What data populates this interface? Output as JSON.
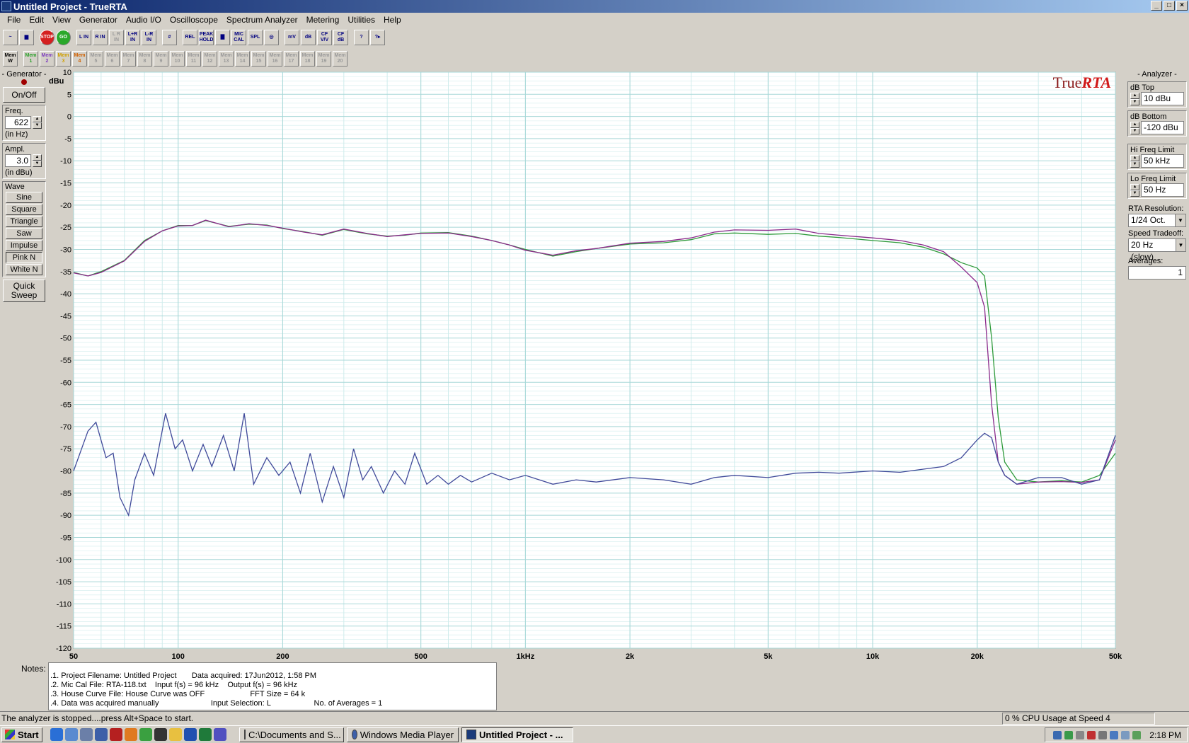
{
  "window": {
    "title": "Untitled Project - TrueRTA"
  },
  "menu": [
    "File",
    "Edit",
    "View",
    "Generator",
    "Audio I/O",
    "Oscilloscope",
    "Spectrum Analyzer",
    "Metering",
    "Utilities",
    "Help"
  ],
  "toolbar1": [
    {
      "label": "~",
      "name": "sine-wave-icon"
    },
    {
      "label": "▆",
      "name": "rta-icon"
    },
    {
      "label": "STOP",
      "name": "stop-button"
    },
    {
      "label": "GO",
      "name": "go-button"
    },
    {
      "label": "L IN",
      "name": "l-in-button"
    },
    {
      "label": "R IN",
      "name": "r-in-button"
    },
    {
      "label": "L R IN",
      "name": "lr-in-button"
    },
    {
      "label": "L+R IN",
      "name": "l-plus-r-in-button"
    },
    {
      "label": "L-R IN",
      "name": "l-minus-r-in-button"
    },
    {
      "label": "#",
      "name": "grid-icon"
    },
    {
      "label": "REL",
      "name": "rel-button"
    },
    {
      "label": "PEAK HOLD",
      "name": "peak-hold-button"
    },
    {
      "label": "▇",
      "name": "bars-icon"
    },
    {
      "label": "MIC CAL",
      "name": "mic-cal-button"
    },
    {
      "label": "SPL",
      "name": "spl-button"
    },
    {
      "label": "◎",
      "name": "target-icon"
    },
    {
      "label": "mV",
      "name": "mv-button"
    },
    {
      "label": "dB",
      "name": "db-button"
    },
    {
      "label": "CF V/V",
      "name": "cf-vv-button"
    },
    {
      "label": "CF dB",
      "name": "cf-db-button"
    },
    {
      "label": "?",
      "name": "help-icon"
    },
    {
      "label": "?▸",
      "name": "context-help-icon"
    }
  ],
  "memory_buttons": [
    "Mem W",
    "Mem 1",
    "Mem 2",
    "Mem 3",
    "Mem 4",
    "Mem 5",
    "Mem 6",
    "Mem 7",
    "Mem 8",
    "Mem 9",
    "Mem 10",
    "Mem 11",
    "Mem 12",
    "Mem 13",
    "Mem 14",
    "Mem 15",
    "Mem 16",
    "Mem 17",
    "Mem 18",
    "Mem 19",
    "Mem 20"
  ],
  "generator": {
    "title": "- Generator -",
    "onoff": "On/Off",
    "freq_label": "Freq.",
    "freq_value": "622",
    "freq_unit": "(in Hz)",
    "ampl_label": "Ampl.",
    "ampl_value": "3.0",
    "ampl_unit": "(in dBu)",
    "wave_label": "Wave",
    "waves": [
      "Sine",
      "Square",
      "Triangle",
      "Saw",
      "Impulse",
      "Pink N",
      "White N"
    ],
    "quick_sweep": "Quick Sweep"
  },
  "analyzer": {
    "title": "- Analyzer -",
    "db_top_label": "dB Top",
    "db_top": "10 dBu",
    "db_bottom_label": "dB Bottom",
    "db_bottom": "-120 dBu",
    "hi_freq_label": "Hi Freq Limit",
    "hi_freq": "50 kHz",
    "lo_freq_label": "Lo Freq Limit",
    "lo_freq": "50 Hz",
    "rta_res_label": "RTA Resolution:",
    "rta_res": "1/24 Oct.",
    "speed_label": "Speed Tradeoff:",
    "speed": "20 Hz (slow)",
    "averages_label": "Averages:",
    "averages": "1"
  },
  "chart_data": {
    "type": "line",
    "logo": "TrueRTA",
    "ylabel": "dBu",
    "ylim": [
      -120,
      10
    ],
    "xlim": [
      50,
      50000
    ],
    "xscale": "log",
    "grid": true,
    "x_tick_labels": [
      {
        "value": 50,
        "label": "50"
      },
      {
        "value": 100,
        "label": "100"
      },
      {
        "value": 200,
        "label": "200"
      },
      {
        "value": 500,
        "label": "500"
      },
      {
        "value": 1000,
        "label": "1kHz"
      },
      {
        "value": 2000,
        "label": "2k"
      },
      {
        "value": 5000,
        "label": "5k"
      },
      {
        "value": 10000,
        "label": "10k"
      },
      {
        "value": 20000,
        "label": "20k"
      },
      {
        "value": 50000,
        "label": "50k"
      }
    ],
    "y_ticks": [
      10,
      5,
      0,
      -5,
      -10,
      -15,
      -20,
      -25,
      -30,
      -35,
      -40,
      -45,
      -50,
      -55,
      -60,
      -65,
      -70,
      -75,
      -80,
      -85,
      -90,
      -95,
      -100,
      -105,
      -110,
      -115,
      -120
    ],
    "series": [
      {
        "color": "#2e9a3a",
        "points": [
          [
            50,
            -35.2
          ],
          [
            55,
            -36
          ],
          [
            60,
            -35
          ],
          [
            70,
            -32.5
          ],
          [
            80,
            -28
          ],
          [
            90,
            -25.8
          ],
          [
            100,
            -24.6
          ],
          [
            110,
            -24.6
          ],
          [
            120,
            -23.5
          ],
          [
            140,
            -24.8
          ],
          [
            160,
            -24.3
          ],
          [
            180,
            -24.5
          ],
          [
            200,
            -25.3
          ],
          [
            230,
            -26
          ],
          [
            260,
            -26.8
          ],
          [
            300,
            -25.5
          ],
          [
            350,
            -26.5
          ],
          [
            400,
            -27
          ],
          [
            450,
            -26.8
          ],
          [
            500,
            -26.3
          ],
          [
            600,
            -26.2
          ],
          [
            700,
            -27
          ],
          [
            800,
            -28
          ],
          [
            900,
            -29
          ],
          [
            1000,
            -30
          ],
          [
            1200,
            -31.5
          ],
          [
            1400,
            -30.5
          ],
          [
            1600,
            -29.8
          ],
          [
            2000,
            -28.8
          ],
          [
            2500,
            -28.5
          ],
          [
            3000,
            -27.8
          ],
          [
            3500,
            -26.5
          ],
          [
            4000,
            -26.3
          ],
          [
            5000,
            -26.6
          ],
          [
            6000,
            -26.4
          ],
          [
            7000,
            -27
          ],
          [
            8000,
            -27.3
          ],
          [
            10000,
            -28
          ],
          [
            12000,
            -28.5
          ],
          [
            14000,
            -29.5
          ],
          [
            16000,
            -31
          ],
          [
            18000,
            -33
          ],
          [
            20000,
            -34.2
          ],
          [
            21000,
            -36
          ],
          [
            22000,
            -50
          ],
          [
            23000,
            -68
          ],
          [
            24000,
            -78
          ],
          [
            26000,
            -82
          ],
          [
            30000,
            -82.5
          ],
          [
            35000,
            -82.2
          ],
          [
            40000,
            -82.5
          ],
          [
            45000,
            -81
          ],
          [
            50000,
            -76
          ]
        ]
      },
      {
        "color": "#8b2a8b",
        "points": [
          [
            50,
            -35.3
          ],
          [
            55,
            -36
          ],
          [
            60,
            -35.2
          ],
          [
            70,
            -32.6
          ],
          [
            80,
            -28.2
          ],
          [
            90,
            -25.8
          ],
          [
            100,
            -24.7
          ],
          [
            110,
            -24.6
          ],
          [
            120,
            -23.4
          ],
          [
            140,
            -24.9
          ],
          [
            160,
            -24.2
          ],
          [
            180,
            -24.6
          ],
          [
            200,
            -25.2
          ],
          [
            230,
            -26.1
          ],
          [
            260,
            -26.7
          ],
          [
            300,
            -25.4
          ],
          [
            350,
            -26.4
          ],
          [
            400,
            -27.1
          ],
          [
            450,
            -26.7
          ],
          [
            500,
            -26.4
          ],
          [
            600,
            -26.3
          ],
          [
            700,
            -27.1
          ],
          [
            800,
            -28
          ],
          [
            900,
            -29
          ],
          [
            1000,
            -30.2
          ],
          [
            1200,
            -31.3
          ],
          [
            1400,
            -30.3
          ],
          [
            1600,
            -29.8
          ],
          [
            2000,
            -28.6
          ],
          [
            2500,
            -28.2
          ],
          [
            3000,
            -27.4
          ],
          [
            3500,
            -26.1
          ],
          [
            4000,
            -25.6
          ],
          [
            5000,
            -25.7
          ],
          [
            6000,
            -25.4
          ],
          [
            7000,
            -26.4
          ],
          [
            8000,
            -26.8
          ],
          [
            10000,
            -27.4
          ],
          [
            12000,
            -28
          ],
          [
            14000,
            -29
          ],
          [
            16000,
            -30.5
          ],
          [
            18000,
            -34
          ],
          [
            20000,
            -37.5
          ],
          [
            21000,
            -43
          ],
          [
            22000,
            -65
          ],
          [
            23000,
            -78
          ],
          [
            24000,
            -81
          ],
          [
            26000,
            -83
          ],
          [
            30000,
            -82.5
          ],
          [
            35000,
            -82.4
          ],
          [
            40000,
            -82.6
          ],
          [
            45000,
            -82
          ],
          [
            50000,
            -73
          ]
        ]
      },
      {
        "color": "#404a9a",
        "points": [
          [
            50,
            -80
          ],
          [
            55,
            -71
          ],
          [
            58,
            -69
          ],
          [
            62,
            -77
          ],
          [
            65,
            -76
          ],
          [
            68,
            -86
          ],
          [
            72,
            -90
          ],
          [
            75,
            -82
          ],
          [
            80,
            -76
          ],
          [
            85,
            -81
          ],
          [
            92,
            -67
          ],
          [
            98,
            -75
          ],
          [
            103,
            -73
          ],
          [
            110,
            -80
          ],
          [
            118,
            -74
          ],
          [
            125,
            -79
          ],
          [
            135,
            -72
          ],
          [
            145,
            -80
          ],
          [
            155,
            -67
          ],
          [
            165,
            -83
          ],
          [
            180,
            -77
          ],
          [
            195,
            -81
          ],
          [
            210,
            -78
          ],
          [
            225,
            -85
          ],
          [
            240,
            -76
          ],
          [
            260,
            -87
          ],
          [
            280,
            -79
          ],
          [
            300,
            -86
          ],
          [
            320,
            -75
          ],
          [
            340,
            -82
          ],
          [
            360,
            -79
          ],
          [
            390,
            -85
          ],
          [
            420,
            -80
          ],
          [
            450,
            -83
          ],
          [
            480,
            -76
          ],
          [
            520,
            -83
          ],
          [
            560,
            -81
          ],
          [
            600,
            -83
          ],
          [
            650,
            -81
          ],
          [
            700,
            -82.5
          ],
          [
            800,
            -80.5
          ],
          [
            900,
            -82
          ],
          [
            1000,
            -81
          ],
          [
            1200,
            -83
          ],
          [
            1400,
            -82
          ],
          [
            1600,
            -82.5
          ],
          [
            2000,
            -81.5
          ],
          [
            2500,
            -82
          ],
          [
            3000,
            -83
          ],
          [
            3500,
            -81.5
          ],
          [
            4000,
            -81
          ],
          [
            5000,
            -81.5
          ],
          [
            6000,
            -80.5
          ],
          [
            7000,
            -80.3
          ],
          [
            8000,
            -80.5
          ],
          [
            10000,
            -80
          ],
          [
            12000,
            -80.3
          ],
          [
            14000,
            -79.6
          ],
          [
            16000,
            -79
          ],
          [
            18000,
            -77
          ],
          [
            20000,
            -73
          ],
          [
            21000,
            -71.5
          ],
          [
            22000,
            -72.5
          ],
          [
            23000,
            -78
          ],
          [
            24000,
            -81
          ],
          [
            26000,
            -83
          ],
          [
            30000,
            -81.5
          ],
          [
            35000,
            -81.5
          ],
          [
            40000,
            -83
          ],
          [
            45000,
            -82
          ],
          [
            50000,
            -72
          ]
        ]
      }
    ]
  },
  "notes": {
    "label": "Notes:",
    "lines": [
      ".1. Project Filename: Untitled Project       Data acquired: 17Jun2012, 1:58 PM",
      ".2. Mic Cal File: RTA-118.txt    Input f(s) = 96 kHz    Output f(s) = 96 kHz",
      ".3. House Curve File: House Curve was OFF                     FFT Size = 64 k",
      ".4. Data was acquired manually                        Input Selection: L                    No. of Averages = 1"
    ]
  },
  "status": {
    "text": "The analyzer is stopped....press Alt+Space to start.",
    "cpu": "0 % CPU Usage at Speed 4"
  },
  "taskbar": {
    "start": "Start",
    "tasks": [
      {
        "label": "C:\\Documents and S...",
        "active": false
      },
      {
        "label": "Windows Media Player",
        "active": false
      },
      {
        "label": "Untitled Project - ...",
        "active": true
      }
    ],
    "clock": "2:18 PM"
  },
  "colors": {
    "chart_bg": "#ffffff",
    "grid_major": "#a8d8d8",
    "grid_minor": "#d0ecec",
    "logo_true": "#8a1b1b",
    "logo_rta": "#d01818"
  }
}
